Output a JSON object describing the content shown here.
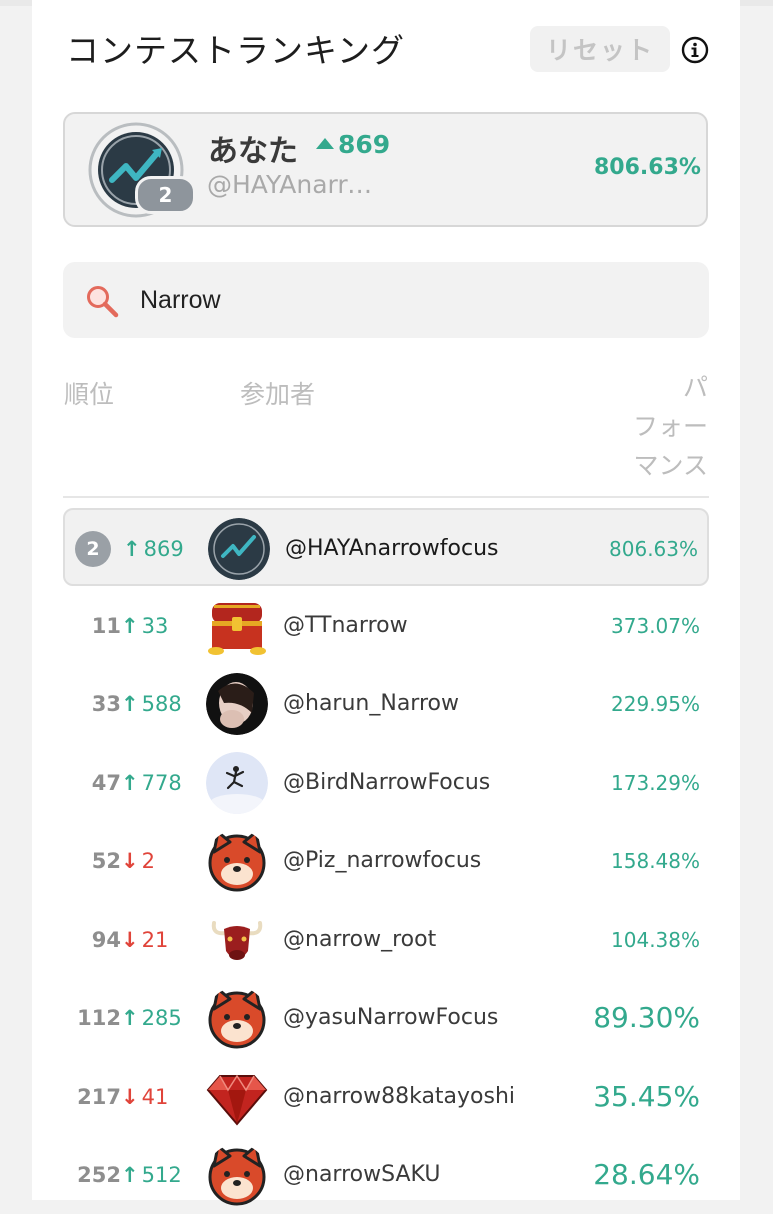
{
  "header": {
    "title": "コンテストランキング",
    "reset_label": "リセット",
    "info_icon": "info-circle-icon"
  },
  "you": {
    "name": "あなた",
    "rank": "2",
    "change": "869",
    "handle": "@HAYAnarro…",
    "performance": "806.63%"
  },
  "search": {
    "icon": "search-icon",
    "value": "Narrow"
  },
  "columns": {
    "rank": "順位",
    "participant": "参加者",
    "performance": [
      "パ",
      "フォー",
      "マンス"
    ]
  },
  "rows": [
    {
      "rank": "2",
      "direction": "up",
      "arrow": "↑",
      "change": "869",
      "handle": "@HAYAnarrowfocus",
      "performance": "806.63%",
      "avatar": "chart-logo-avatar"
    },
    {
      "rank": "11",
      "direction": "up",
      "arrow": "↑",
      "change": "33",
      "handle": "@TTnarrow",
      "performance": "373.07%",
      "avatar": "treasure-chest-avatar"
    },
    {
      "rank": "33",
      "direction": "up",
      "arrow": "↑",
      "change": "588",
      "handle": "@harun_Narrow",
      "performance": "229.95%",
      "avatar": "photo-portrait-avatar"
    },
    {
      "rank": "47",
      "direction": "up",
      "arrow": "↑",
      "change": "778",
      "handle": "@BirdNarrowFocus",
      "performance": "173.29%",
      "avatar": "jumping-person-avatar"
    },
    {
      "rank": "52",
      "direction": "down",
      "arrow": "↓",
      "change": "2",
      "handle": "@Piz_narrowfocus",
      "performance": "158.48%",
      "avatar": "shiba-dog-avatar"
    },
    {
      "rank": "94",
      "direction": "down",
      "arrow": "↓",
      "change": "21",
      "handle": "@narrow_root",
      "performance": "104.38%",
      "avatar": "bull-avatar"
    },
    {
      "rank": "112",
      "direction": "up",
      "arrow": "↑",
      "change": "285",
      "handle": "@yasuNarrowFocus",
      "performance": "89.30%",
      "avatar": "shiba-dog-avatar"
    },
    {
      "rank": "217",
      "direction": "down",
      "arrow": "↓",
      "change": "41",
      "handle": "@narrow88katayoshi",
      "performance": "35.45%",
      "avatar": "ruby-diamond-avatar"
    },
    {
      "rank": "252",
      "direction": "up",
      "arrow": "↑",
      "change": "512",
      "handle": "@narrowSAKU",
      "performance": "28.64%",
      "avatar": "shiba-dog-avatar"
    }
  ],
  "colors": {
    "accent_green": "#33a98d",
    "down_red": "#e0443a",
    "badge_gray": "#9aa0a6"
  }
}
